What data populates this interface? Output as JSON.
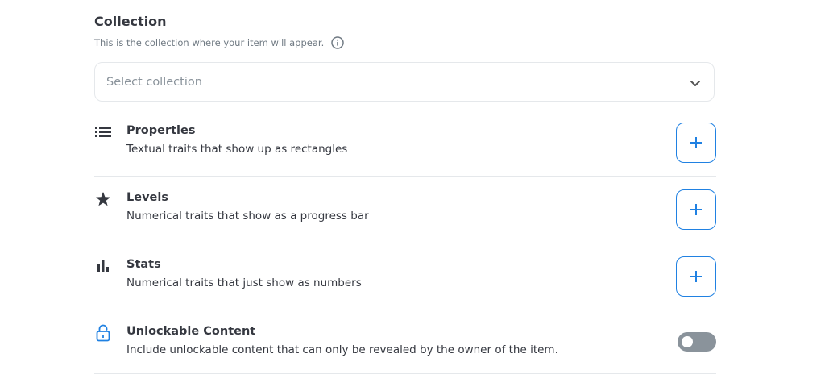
{
  "collection": {
    "title": "Collection",
    "subtitle": "This is the collection where your item will appear.",
    "select_placeholder": "Select collection"
  },
  "rows": [
    {
      "icon": "list-icon",
      "title": "Properties",
      "description": "Textual traits that show up as rectangles",
      "action": "add"
    },
    {
      "icon": "star-icon",
      "title": "Levels",
      "description": "Numerical traits that show as a progress bar",
      "action": "add"
    },
    {
      "icon": "bar-chart-icon",
      "title": "Stats",
      "description": "Numerical traits that just show as numbers",
      "action": "add"
    },
    {
      "icon": "lock-icon",
      "title": "Unlockable Content",
      "description": "Include unlockable content that can only be revealed by the owner of the item.",
      "action": "toggle",
      "toggle_on": false
    }
  ],
  "colors": {
    "accent": "#2081e2",
    "text": "#353840",
    "muted": "#707a83",
    "border": "#e5e8eb",
    "toggle_off": "#8a939b"
  }
}
